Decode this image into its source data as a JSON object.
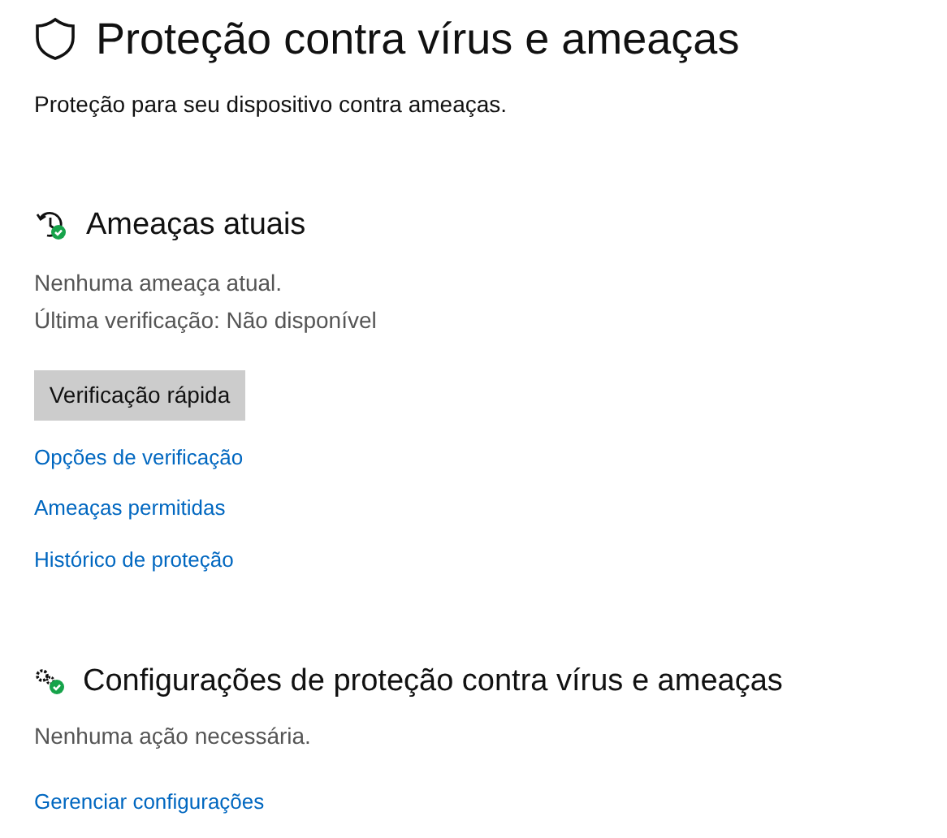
{
  "title": "Proteção contra vírus e ameaças",
  "subtitle": "Proteção para seu dispositivo contra ameaças.",
  "current_threats": {
    "heading": "Ameaças atuais",
    "lines": [
      "Nenhuma ameaça atual.",
      "Última verificação: Não disponível"
    ],
    "button": "Verificação rápida",
    "links": [
      "Opções de verificação",
      "Ameaças permitidas",
      "Histórico de proteção"
    ]
  },
  "settings": {
    "heading": "Configurações de proteção contra vírus e ameaças",
    "status": "Nenhuma ação necessária.",
    "link": "Gerenciar configurações"
  }
}
